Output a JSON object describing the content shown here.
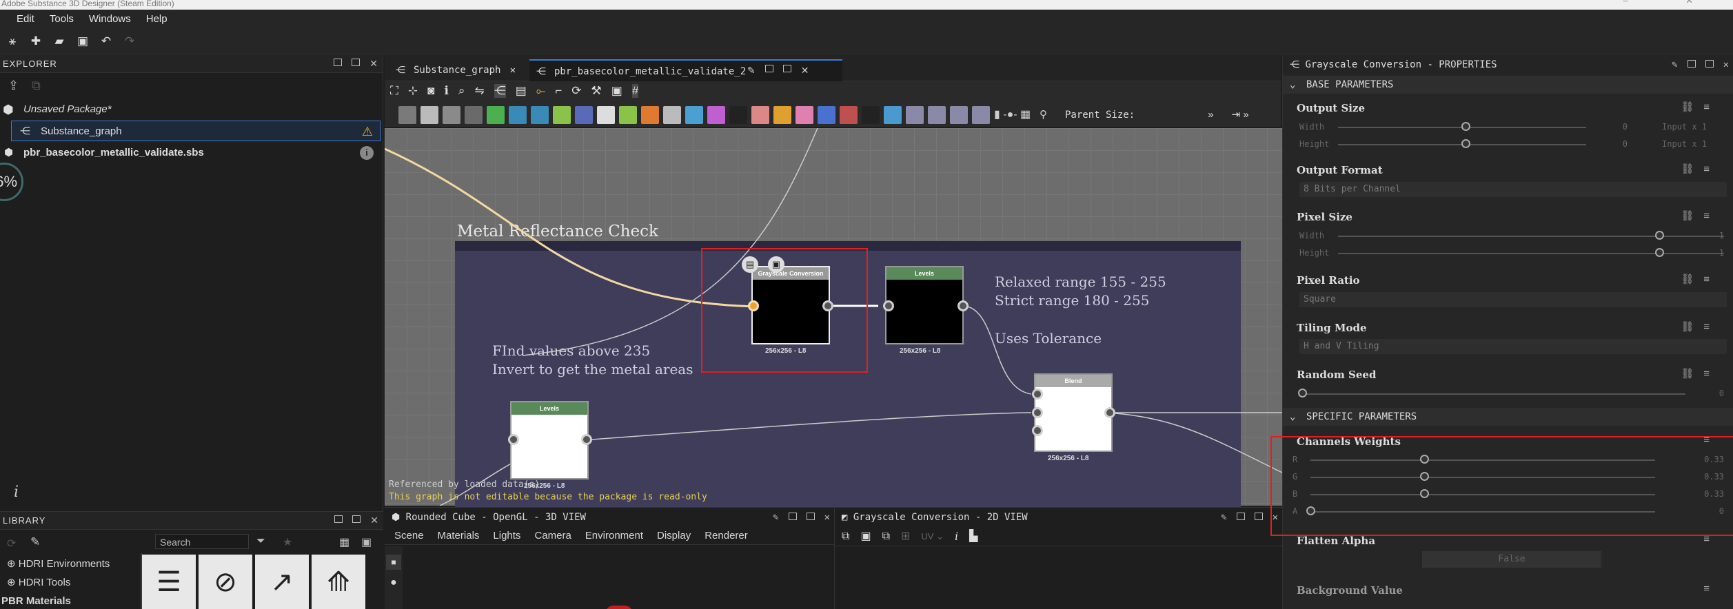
{
  "app": {
    "title": "Adobe Substance 3D Designer (Steam Edition)"
  },
  "menu": [
    "Edit",
    "Tools",
    "Windows",
    "Help"
  ],
  "explorer": {
    "title": "EXPLORER",
    "package": "Unsaved Package*",
    "graph": "Substance_graph",
    "file": "pbr_basecolor_metallic_validate.sbs",
    "zoom": "6%",
    "info": "i"
  },
  "library": {
    "title": "LIBRARY",
    "search_placeholder": "Search",
    "categories": [
      "HDRI Environments",
      "HDRI Tools",
      "PBR Materials"
    ]
  },
  "graph": {
    "tabs": [
      "Substance_graph",
      "pbr_basecolor_metallic_validate_2"
    ],
    "parent_size_label": "Parent Size:",
    "frame_title": "Metal Reflectance Check",
    "comment1": "FInd values above 235\nInvert to get the metal areas",
    "comment2": "Relaxed range 155 - 255\nStrict range 180 - 255",
    "comment3": "Uses Tolerance",
    "nodes": {
      "grayscale": {
        "title": "Grayscale Conversion",
        "size": "256x256 - L8"
      },
      "levels1": {
        "title": "Levels",
        "size": "256x256 - L8"
      },
      "levels2": {
        "title": "Levels",
        "size": "256x256 - L8"
      },
      "blend": {
        "title": "Blend",
        "size": "256x256 - L8"
      }
    },
    "status1": "Referenced by loaded data(s)",
    "status2": "This graph is not editable because the package is read-only"
  },
  "view3d": {
    "title": "Rounded Cube - OpenGL - 3D VIEW",
    "menu": [
      "Scene",
      "Materials",
      "Lights",
      "Camera",
      "Environment",
      "Display",
      "Renderer"
    ]
  },
  "view2d": {
    "title": "Grayscale Conversion - 2D VIEW",
    "uv": "UV"
  },
  "properties": {
    "title": "Grayscale Conversion - PROPERTIES",
    "base_section": "BASE PARAMETERS",
    "specific_section": "SPECIFIC PARAMETERS",
    "output_size": {
      "label": "Output Size",
      "width": "Width",
      "height": "Height",
      "wval": "0",
      "hval": "0",
      "wmode": "Input x 1",
      "hmode": "Input x 1"
    },
    "output_format": {
      "label": "Output Format",
      "value": "8 Bits per Channel"
    },
    "pixel_size": {
      "label": "Pixel Size",
      "width": "Width",
      "height": "Height",
      "wval": "1",
      "hval": "1"
    },
    "pixel_ratio": {
      "label": "Pixel Ratio",
      "value": "Square"
    },
    "tiling_mode": {
      "label": "Tiling Mode",
      "value": "H and V Tiling"
    },
    "random_seed": {
      "label": "Random Seed",
      "value": "0"
    },
    "channels_weights": {
      "label": "Channels Weights",
      "r": "R",
      "g": "G",
      "b": "B",
      "a": "A",
      "rv": "0.33",
      "gv": "0.33",
      "bv": "0.33",
      "av": "0"
    },
    "flatten_alpha": {
      "label": "Flatten Alpha",
      "value": "False"
    },
    "background_value": {
      "label": "Background Value"
    }
  }
}
